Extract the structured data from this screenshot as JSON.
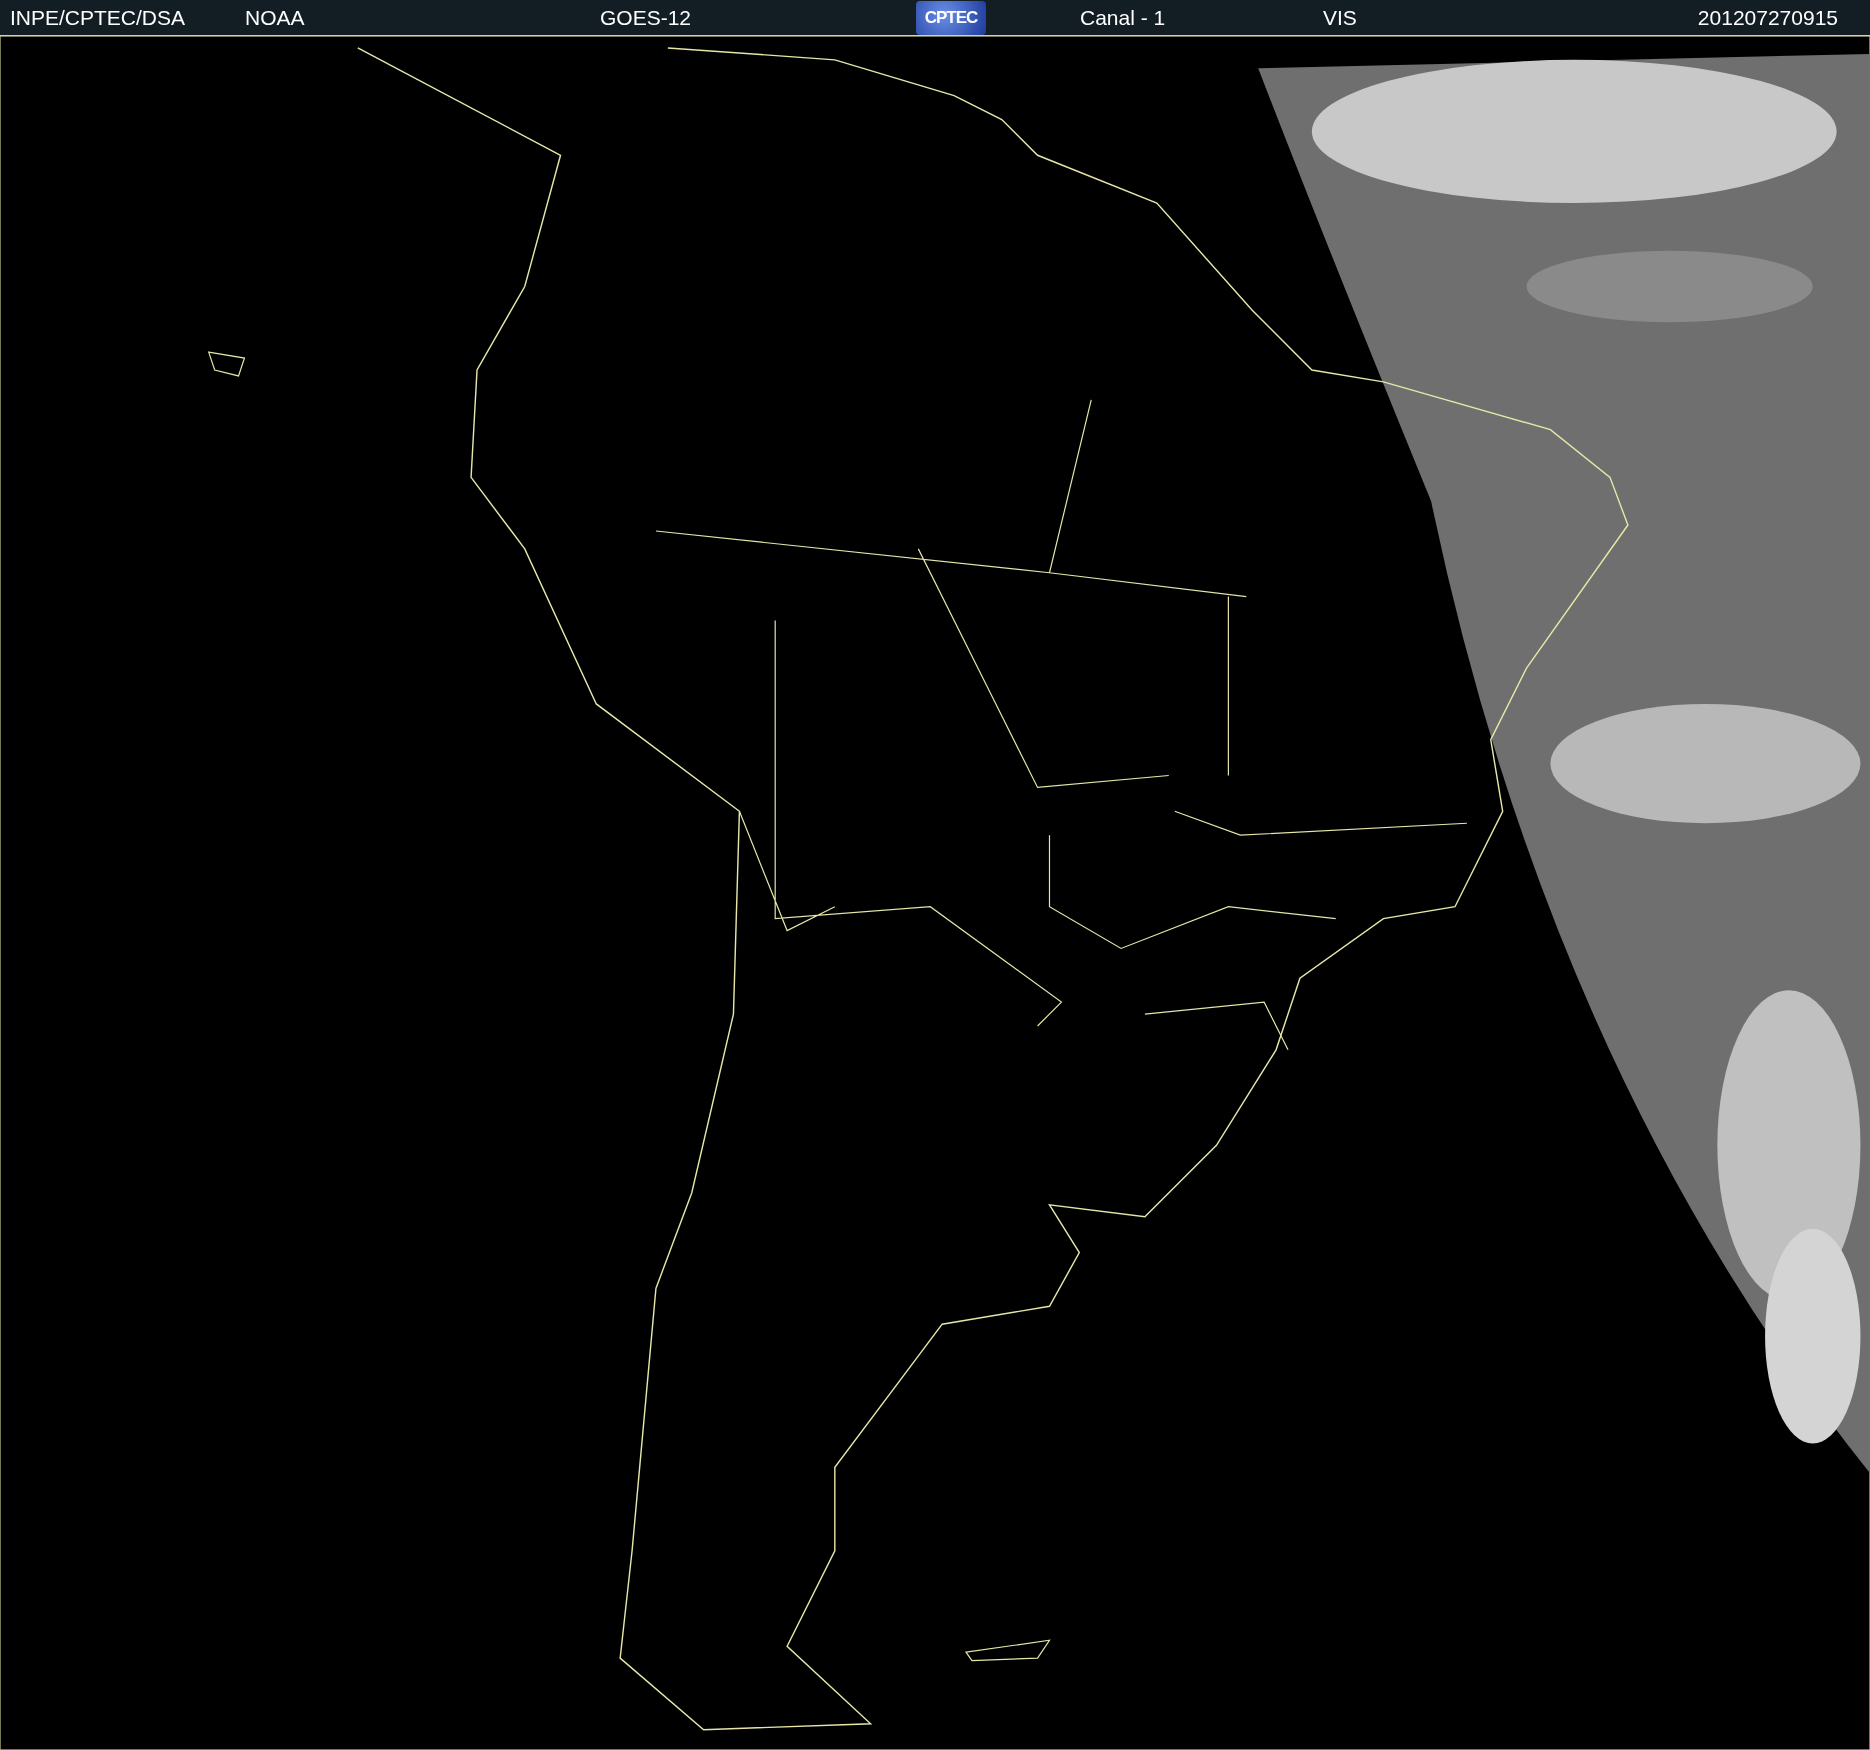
{
  "header": {
    "source": "INPE/CPTEC/DSA",
    "agency": "NOAA",
    "satellite": "GOES-12",
    "logo": "CPTEC",
    "channel": "Canal - 1",
    "band": "VIS",
    "timestamp": "201207270915"
  }
}
